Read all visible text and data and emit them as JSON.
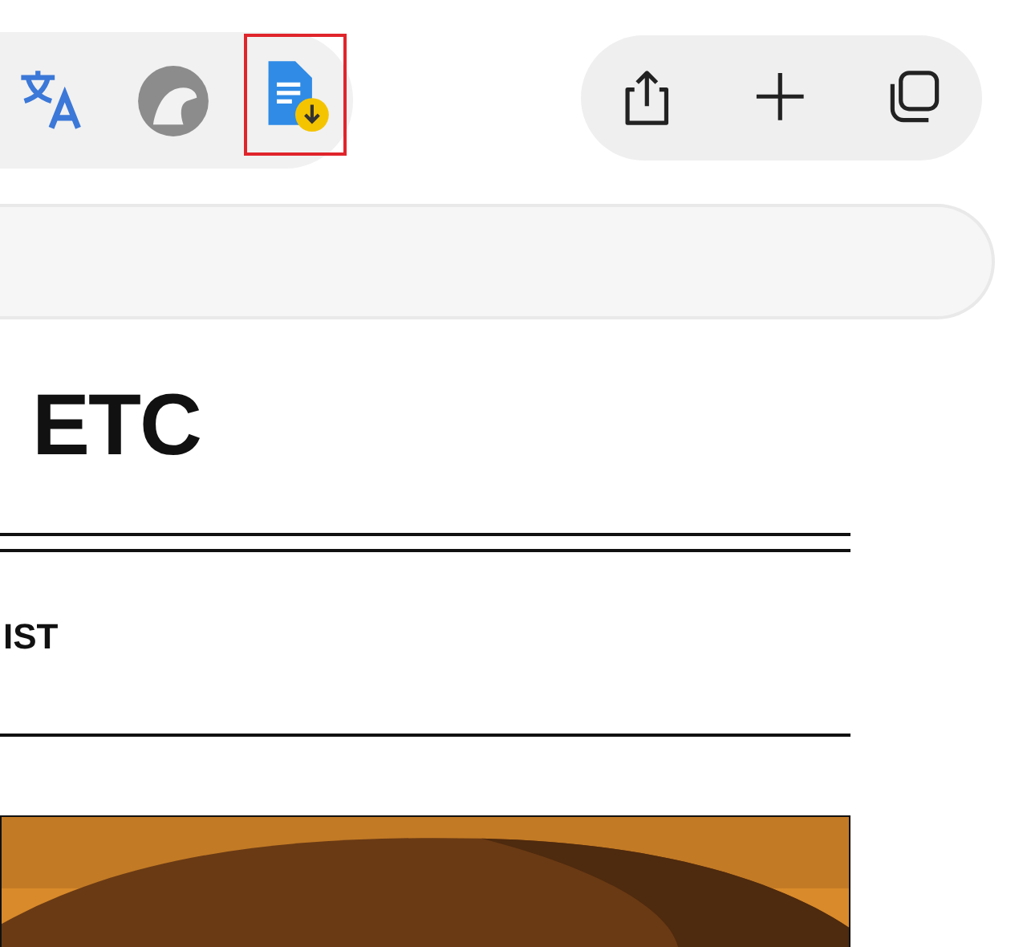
{
  "toolbar": {
    "extensions": [
      {
        "kind": "translate",
        "highlighted": false
      },
      {
        "kind": "avatar",
        "highlighted": false
      },
      {
        "kind": "document-download",
        "highlighted": true
      }
    ],
    "actions": [
      {
        "kind": "share"
      },
      {
        "kind": "new-tab"
      },
      {
        "kind": "tabs"
      }
    ]
  },
  "page": {
    "heading": "ETC",
    "subheading": "IST"
  }
}
